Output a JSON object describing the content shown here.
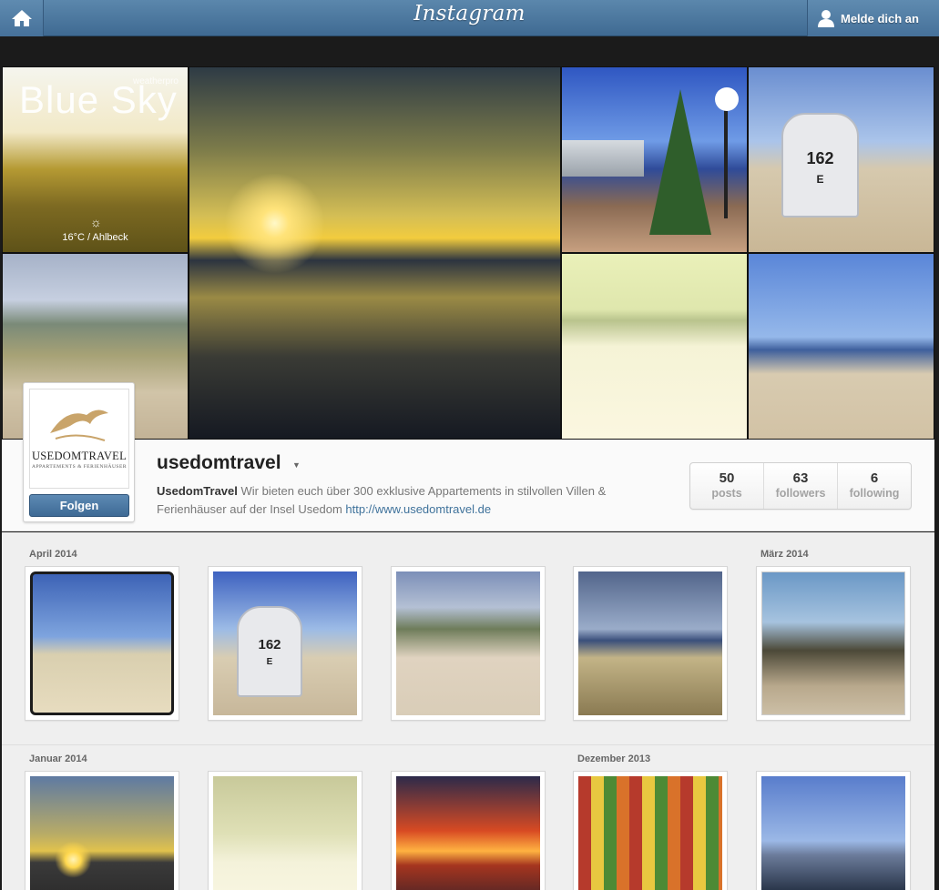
{
  "topbar": {
    "brand": "Instagram",
    "login_label": "Melde dich an"
  },
  "header_mosaic": {
    "tile1_title": "Blue Sky",
    "tile1_watermark": "weatherpro",
    "tile1_weather": "16°C / Ahlbeck",
    "tile4_chair_number": "162",
    "tile4_chair_letter": "E"
  },
  "profile": {
    "avatar_logo": "USEDOMTRAVEL",
    "avatar_sub": "APPARTEMENTS & FERIENHÄUSER",
    "follow_label": "Folgen",
    "username": "usedomtravel",
    "bio_name": "UsedomTravel",
    "bio_text": " Wir bieten euch über 300 exklusive Appartements in stilvollen Villen & Ferienhäuser auf der Insel Usedom ",
    "bio_link": "http://www.usedomtravel.de",
    "stats": [
      {
        "num": "50",
        "label": "posts"
      },
      {
        "num": "63",
        "label": "followers"
      },
      {
        "num": "6",
        "label": "following"
      }
    ]
  },
  "feed": {
    "months": [
      "April 2014",
      "März 2014",
      "Januar 2014",
      "Dezember 2013"
    ],
    "photo_chair_number": "162",
    "photo_chair_letter": "E"
  },
  "colors": {
    "topbar": "#4a769e",
    "follow_button": "#4a769e",
    "link": "#3f729b",
    "background": "#efefef"
  }
}
